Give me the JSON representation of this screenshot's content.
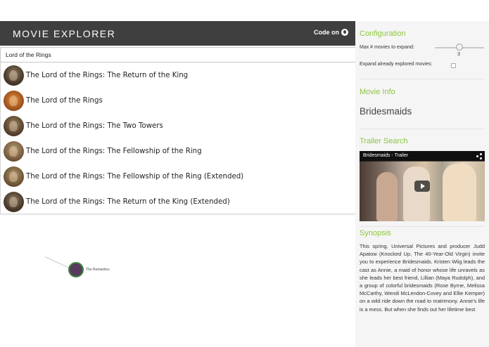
{
  "header": {
    "brand": "MOVIE EXPLORER",
    "code_link": "Code on"
  },
  "search": {
    "value": "Lord of the Rings"
  },
  "suggestions": [
    {
      "label": "The Lord of the Rings: The Return of the King"
    },
    {
      "label": "The Lord of the Rings"
    },
    {
      "label": "The Lord of the Rings: The Two Towers"
    },
    {
      "label": "The Lord of the Rings: The Fellowship of the Ring"
    },
    {
      "label": "The Lord of the Rings: The Fellowship of the Ring (Extended)"
    },
    {
      "label": "The Lord of the Rings: The Return of the King (Extended)"
    }
  ],
  "graph": {
    "node_label": "The Romantics"
  },
  "sidebar": {
    "config_heading": "Configuration",
    "max_label": "Max # movies to expand:",
    "max_value": "3",
    "max_slider_level_fraction": 0.5,
    "expand_label": "Expand already explored movies:",
    "expand_checked": false,
    "movie_info_heading": "Movie Info",
    "movie_title": "Bridesmaids",
    "trailer_heading": "Trailer Search",
    "trailer_title": "Bridesmaids - Trailer",
    "synopsis_heading": "Synopsis",
    "synopsis_text": "This spring, Universal Pictures and producer Judd Apatow (Knocked Up, The 40-Year-Old Virgin) invite you to experience Bridesmaids. Kristen Wiig leads the cast as Annie, a maid of honor whose life unravels as she leads her best friend, Lillian (Maya Rudolph), and a group of colorful bridesmaids (Rose Byrne, Melissa McCarthy, Wendi McLendon-Covey and Ellie Kemper) on a wild ride down the road to matrimony. Annie's life is a mess. But when she finds out her lifetime best"
  },
  "colors": {
    "header_bg": "#3f3f3f",
    "accent": "#8cc63f",
    "sidebar_bg": "#f5f5f5"
  },
  "icons": {
    "code_link": "github-icon",
    "video_share": "share-icon",
    "video_play": "play-icon"
  }
}
